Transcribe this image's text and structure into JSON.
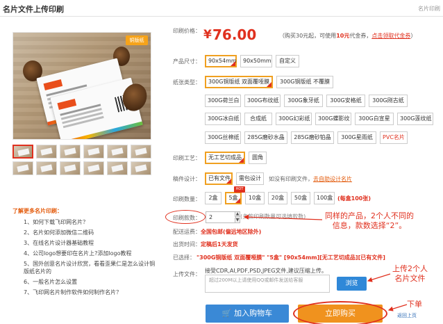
{
  "header": {
    "title": "名片文件上传印刷",
    "crumb": "名片印刷"
  },
  "product_image": {
    "tag": "铜版纸"
  },
  "knowledge": {
    "title": "了解更多名片印刷：",
    "items": [
      "1、如何下载飞印网名片？",
      "2、名片如何添加微信二维码",
      "3、在线名片设计器基础教程",
      "4、公司logo想要印在名片上?添加logo教程",
      "5、国外创意名片设计欣赏，看看歪果仁是怎么设计铜版纸名片的",
      "6、一般名片怎么设置",
      "7、飞印网名片制作软件如何制作名片？"
    ]
  },
  "price": {
    "label": "印刷价格：",
    "symbol": "¥",
    "amount": "76.00",
    "note_pre": "（购买30元起，可使用",
    "note_em": "10元",
    "note_mid": "代金券，",
    "coupon_link": "点击领取代金券",
    "note_post": "）"
  },
  "size": {
    "label": "产品尺寸：",
    "options": [
      "90x54mm",
      "90x50mm",
      "自定义"
    ],
    "selected": "90x54mm"
  },
  "paper": {
    "label": "纸张类型：",
    "options": [
      "300G铜版纸 双面覆哑膜",
      "300G铜版纸 不覆膜",
      "300G荷兰白",
      "300G布纹纸",
      "300G象牙纸",
      "300G安格纸",
      "300G刚古纸",
      "300G冰白纸",
      "合成纸",
      "300G幻彩纸",
      "300G蝶影纹",
      "300G白宣星",
      "300G莲纹纸",
      "300G丝棉纸",
      "285G磨砂水晶",
      "285G磨砂铂晶",
      "300G星雨纸",
      "PVC名片"
    ],
    "selected": "300G铜版纸 双面覆哑膜"
  },
  "craft": {
    "label": "印刷工艺：",
    "options": [
      "无工艺切成品",
      "圆角"
    ],
    "selected": "无工艺切成品"
  },
  "design": {
    "label": "稿件设计：",
    "options": [
      "已有文件",
      "需包设计"
    ],
    "selected": "已有文件",
    "note_pre": "如没有印刷文件，",
    "note_link": "去自助设计名片"
  },
  "quantity": {
    "label": "印刷数量：",
    "options": [
      "2盒",
      "5盒",
      "10盒",
      "20盒",
      "50盒",
      "100盒"
    ],
    "selected": "5盒",
    "hot_badge": "HOT",
    "note": "(每盒100张)"
  },
  "count": {
    "label": "印刷款数：",
    "value": "2",
    "suffix": "(多款印刷数量可选填款数)"
  },
  "shipping": {
    "label": "配送运费：",
    "value": "全国包邮(偏远地区除外)"
  },
  "ship_time": {
    "label": "出货时间：",
    "value": "定稿后1天发货"
  },
  "selected_summary": {
    "label": "已选择：",
    "value": "\"300G铜版纸 双面覆哑膜\" \"5盒\" [90x54mm][无工艺切成品][已有文件]"
  },
  "upload": {
    "label": "上传文件：",
    "hint": "接受CDR,AI,PDF,PSD,JPEG文件,建议压缩上传。",
    "placeholder": "超过200M以上请使用QQ或邮件发送给客服",
    "browse": "浏览"
  },
  "actions": {
    "cart": "加入购物车",
    "buy": "立即购买",
    "back_top": "返回上页"
  },
  "annotations": {
    "note1_line1": "同样的产品，2个人不同的",
    "note1_line2": "信息，款数选择“2”。",
    "note2_line1": "上传2个人",
    "note2_line2": "名片文件",
    "note3": "下单"
  },
  "colors": {
    "accent_red": "#e0301e",
    "accent_orange": "#f0921e",
    "accent_blue": "#3a89d6"
  }
}
